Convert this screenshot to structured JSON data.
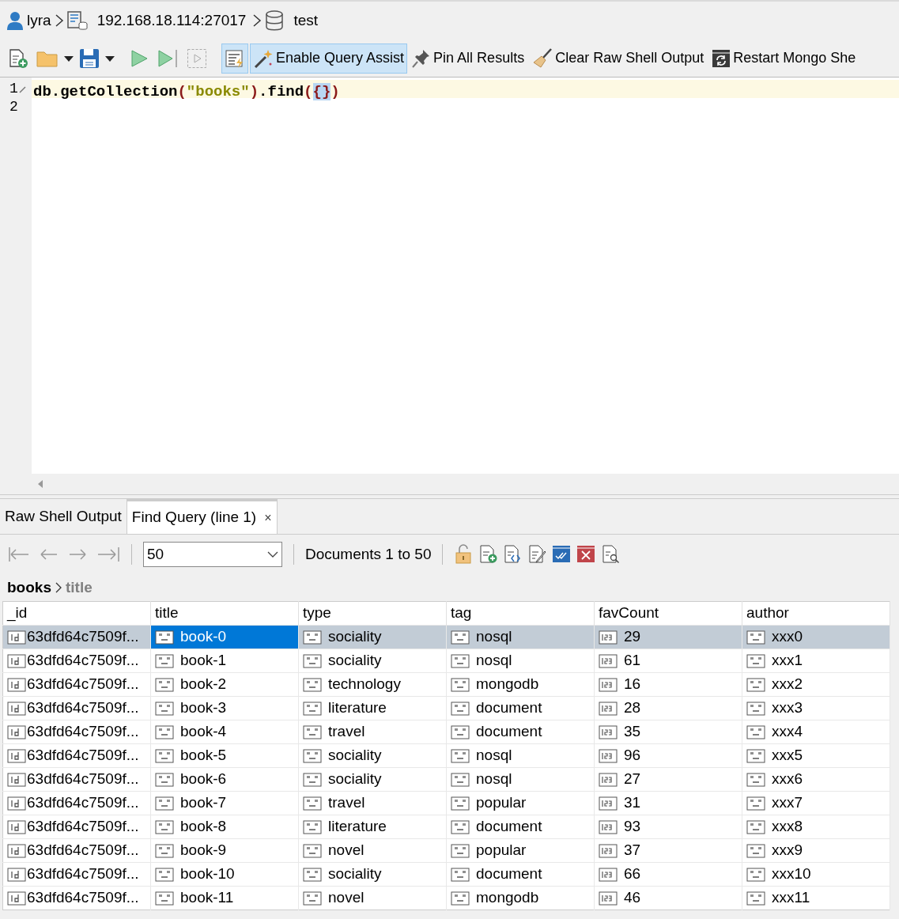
{
  "breadcrumb": [
    {
      "kind": "user",
      "text": "lyra"
    },
    {
      "kind": "server",
      "text": "192.168.18.114:27017"
    },
    {
      "kind": "database",
      "text": "test"
    }
  ],
  "toolbar": [
    {
      "kind": "new-script",
      "highlighted": false
    },
    {
      "kind": "open",
      "highlighted": false
    },
    {
      "kind": "save",
      "highlighted": false
    },
    {
      "kind": "run",
      "highlighted": false
    },
    {
      "kind": "run-line",
      "highlighted": false
    },
    {
      "kind": "run-selection",
      "highlighted": false
    },
    {
      "kind": "query-code",
      "highlighted": true
    },
    {
      "kind": "wand",
      "label": "Enable Query Assist",
      "highlighted": true
    },
    {
      "kind": "pin",
      "label": "Pin All Results",
      "highlighted": false
    },
    {
      "kind": "broom",
      "label": "Clear Raw Shell Output",
      "highlighted": false
    },
    {
      "kind": "restart",
      "label": "Restart Mongo She",
      "highlighted": false
    }
  ],
  "editor": {
    "lines": [
      {
        "number": "1",
        "current": true,
        "tokens": [
          {
            "kind": "plain",
            "text": "db.getCollection"
          },
          {
            "kind": "paren",
            "text": "("
          },
          {
            "kind": "string",
            "text": "\"books\""
          },
          {
            "kind": "paren",
            "text": ")"
          },
          {
            "kind": "plain",
            "text": ".find"
          },
          {
            "kind": "paren",
            "text": "("
          },
          {
            "kind": "brace",
            "text": "{}"
          },
          {
            "kind": "paren",
            "text": ")"
          }
        ]
      },
      {
        "number": "2",
        "current": false
      }
    ]
  },
  "tabs": [
    {
      "label": "Raw Shell Output",
      "selected": false,
      "closable": false
    },
    {
      "label": "Find Query (line 1)",
      "selected": true,
      "closable": true,
      "close": "×"
    }
  ],
  "pager": {
    "page_size": "50",
    "info": "Documents 1 to 50"
  },
  "path": [
    {
      "text": "books",
      "current": false
    },
    {
      "text": "title",
      "current": true
    }
  ],
  "table": {
    "columns": [
      {
        "label": "_id",
        "kind": "objectid"
      },
      {
        "label": "title",
        "kind": "string"
      },
      {
        "label": "type",
        "kind": "string"
      },
      {
        "label": "tag",
        "kind": "string"
      },
      {
        "label": "favCount",
        "kind": "int32"
      },
      {
        "label": "author",
        "kind": "string"
      }
    ],
    "rows": [
      {
        "selected": true,
        "cells": [
          {
            "text": "63dfd64c7509f...",
            "selected": false
          },
          {
            "text": "book-0",
            "selected": true
          },
          {
            "text": "sociality",
            "selected": false
          },
          {
            "text": "nosql",
            "selected": false
          },
          {
            "text": "29",
            "selected": false
          },
          {
            "text": "xxx0",
            "selected": false
          }
        ]
      },
      {
        "selected": false,
        "cells": [
          "63dfd64c7509f...",
          "book-1",
          "sociality",
          "nosql",
          "61",
          "xxx1"
        ]
      },
      {
        "selected": false,
        "cells": [
          "63dfd64c7509f...",
          "book-2",
          "technology",
          "mongodb",
          "16",
          "xxx2"
        ]
      },
      {
        "selected": false,
        "cells": [
          "63dfd64c7509f...",
          "book-3",
          "literature",
          "document",
          "28",
          "xxx3"
        ]
      },
      {
        "selected": false,
        "cells": [
          "63dfd64c7509f...",
          "book-4",
          "travel",
          "document",
          "35",
          "xxx4"
        ]
      },
      {
        "selected": false,
        "cells": [
          "63dfd64c7509f...",
          "book-5",
          "sociality",
          "nosql",
          "96",
          "xxx5"
        ]
      },
      {
        "selected": false,
        "cells": [
          "63dfd64c7509f...",
          "book-6",
          "sociality",
          "nosql",
          "27",
          "xxx6"
        ]
      },
      {
        "selected": false,
        "cells": [
          "63dfd64c7509f...",
          "book-7",
          "travel",
          "popular",
          "31",
          "xxx7"
        ]
      },
      {
        "selected": false,
        "cells": [
          "63dfd64c7509f...",
          "book-8",
          "literature",
          "document",
          "93",
          "xxx8"
        ]
      },
      {
        "selected": false,
        "cells": [
          "63dfd64c7509f...",
          "book-9",
          "novel",
          "popular",
          "37",
          "xxx9"
        ]
      },
      {
        "selected": false,
        "cells": [
          "63dfd64c7509f...",
          "book-10",
          "sociality",
          "document",
          "66",
          "xxx10"
        ]
      },
      {
        "selected": false,
        "cells": [
          "63dfd64c7509f...",
          "book-11",
          "novel",
          "mongodb",
          "46",
          "xxx11"
        ]
      }
    ]
  }
}
